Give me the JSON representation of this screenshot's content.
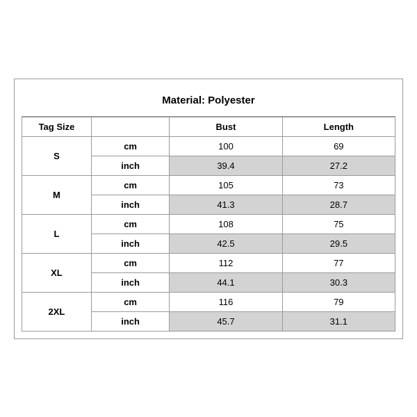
{
  "title": "Material: Polyester",
  "headers": {
    "tag_size": "Tag Size",
    "bust": "Bust",
    "length": "Length"
  },
  "sizes": [
    {
      "tag": "S",
      "rows": [
        {
          "unit": "cm",
          "bust": "100",
          "length": "69",
          "shaded": false
        },
        {
          "unit": "inch",
          "bust": "39.4",
          "length": "27.2",
          "shaded": true
        }
      ]
    },
    {
      "tag": "M",
      "rows": [
        {
          "unit": "cm",
          "bust": "105",
          "length": "73",
          "shaded": false
        },
        {
          "unit": "inch",
          "bust": "41.3",
          "length": "28.7",
          "shaded": true
        }
      ]
    },
    {
      "tag": "L",
      "rows": [
        {
          "unit": "cm",
          "bust": "108",
          "length": "75",
          "shaded": false
        },
        {
          "unit": "inch",
          "bust": "42.5",
          "length": "29.5",
          "shaded": true
        }
      ]
    },
    {
      "tag": "XL",
      "rows": [
        {
          "unit": "cm",
          "bust": "112",
          "length": "77",
          "shaded": false
        },
        {
          "unit": "inch",
          "bust": "44.1",
          "length": "30.3",
          "shaded": true
        }
      ]
    },
    {
      "tag": "2XL",
      "rows": [
        {
          "unit": "cm",
          "bust": "116",
          "length": "79",
          "shaded": false
        },
        {
          "unit": "inch",
          "bust": "45.7",
          "length": "31.1",
          "shaded": true
        }
      ]
    }
  ]
}
